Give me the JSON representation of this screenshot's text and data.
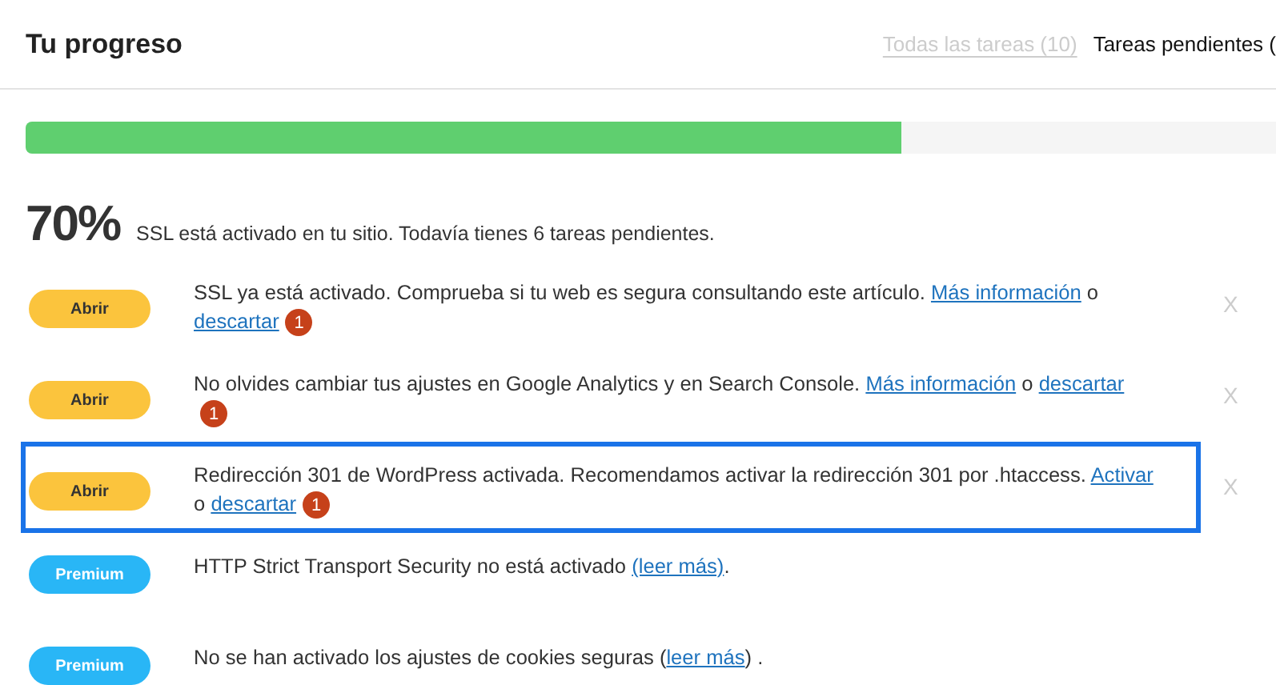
{
  "header": {
    "title": "Tu progreso",
    "tabs": [
      {
        "label": "Todas las tareas (10)",
        "selected": false
      },
      {
        "label": "Tareas pendientes (",
        "selected": true
      }
    ]
  },
  "progress": {
    "level": 0.7,
    "percent": "70%",
    "summary": "SSL está activado en tu sitio. Todavía tienes 6 tareas pendientes."
  },
  "tasks": [
    {
      "kind": "open",
      "button": "Abrir",
      "highlighted": false,
      "parts": [
        {
          "text": "SSL ya está activado. Comprueba si tu web es segura consultando este artículo. ",
          "link": false
        },
        {
          "text": "Más información",
          "link": true
        },
        {
          "text": " o ",
          "link": false
        },
        {
          "text": "descartar",
          "link": true
        }
      ],
      "badge": "1",
      "dismiss": "X"
    },
    {
      "kind": "open",
      "button": "Abrir",
      "highlighted": false,
      "parts": [
        {
          "text": "No olvides cambiar tus ajustes en Google Analytics y en Search Console. ",
          "link": false
        },
        {
          "text": "Más información",
          "link": true
        },
        {
          "text": " o ",
          "link": false
        },
        {
          "text": "descartar",
          "link": true
        }
      ],
      "badge": "1",
      "dismiss": "X"
    },
    {
      "kind": "open",
      "button": "Abrir",
      "highlighted": true,
      "parts": [
        {
          "text": "Redirección 301 de WordPress activada. Recomendamos activar la redirección 301 por .htaccess. ",
          "link": false
        },
        {
          "text": "Activar",
          "link": true
        },
        {
          "text": " o ",
          "link": false
        },
        {
          "text": "descartar",
          "link": true
        }
      ],
      "badge": "1",
      "dismiss": "X"
    },
    {
      "kind": "premium",
      "button": "Premium",
      "highlighted": false,
      "parts": [
        {
          "text": "HTTP Strict Transport Security no está activado ",
          "link": false
        },
        {
          "text": "(leer más)",
          "link": true
        },
        {
          "text": ".",
          "link": false
        }
      ]
    },
    {
      "kind": "premium",
      "button": "Premium",
      "highlighted": false,
      "parts": [
        {
          "text": "No se han activado los ajustes de cookies seguras (",
          "link": false
        },
        {
          "text": "leer más",
          "link": true
        },
        {
          "text": ") .",
          "link": false
        }
      ]
    }
  ]
}
